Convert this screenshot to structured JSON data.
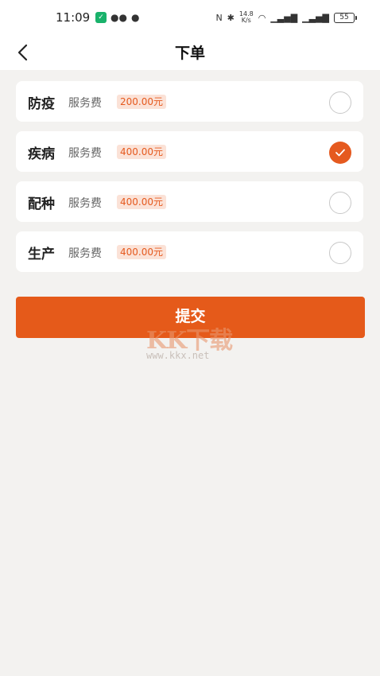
{
  "status_bar": {
    "time": "11:09",
    "speed_top": "14.8",
    "speed_unit": "K/s",
    "battery": "55"
  },
  "header": {
    "title": "下单"
  },
  "options": [
    {
      "name": "防疫",
      "fee_label": "服务费",
      "price": "200.00元",
      "selected": false
    },
    {
      "name": "疾病",
      "fee_label": "服务费",
      "price": "400.00元",
      "selected": true
    },
    {
      "name": "配种",
      "fee_label": "服务费",
      "price": "400.00元",
      "selected": false
    },
    {
      "name": "生产",
      "fee_label": "服务费",
      "price": "400.00元",
      "selected": false
    }
  ],
  "submit_label": "提交",
  "watermark": {
    "logo_text": "KK下载",
    "url": "www.kkx.net"
  },
  "colors": {
    "accent": "#e55a1a",
    "price_bg": "#fbe2d7",
    "background": "#f3f2f0"
  }
}
